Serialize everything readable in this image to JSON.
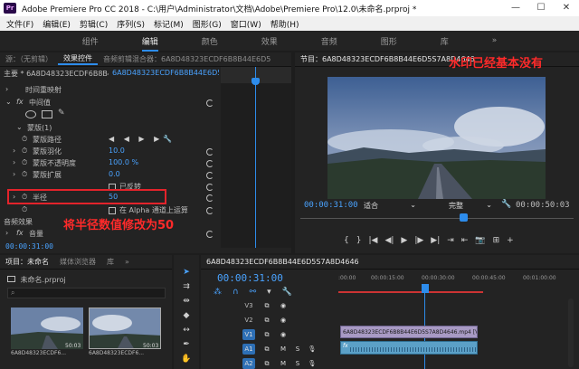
{
  "app": {
    "title": "Adobe Premiere Pro CC 2018 - C:\\用户\\Administrator\\文档\\Adobe\\Premiere Pro\\12.0\\未命名.prproj *",
    "logo_text": "Pr",
    "window_buttons": [
      "—",
      "☐",
      "✕"
    ]
  },
  "menu": [
    "文件(F)",
    "编辑(E)",
    "剪辑(C)",
    "序列(S)",
    "标记(M)",
    "图形(G)",
    "窗口(W)",
    "帮助(H)"
  ],
  "workspaces": {
    "items": [
      "组件",
      "编辑",
      "颜色",
      "效果",
      "音频",
      "图形",
      "库"
    ],
    "active": "编辑",
    "more": "»"
  },
  "effect_controls": {
    "tabs": [
      "源：（无剪辑）",
      "效果控件",
      "音频剪辑混合器：6A8D48323ECDF6B8B44E6D5",
      "元数据"
    ],
    "menu_icon": "≡",
    "master_label": "主要 * 6A8D48323ECDF6B8B4...",
    "clip_label": "6A8D48323ECDF6B8B44E6D5...",
    "rows": {
      "time_remap": "时间重映射",
      "intermediate": "中间值",
      "mask_name": "蒙版(1)",
      "mask_path": "蒙版路径",
      "mask_feather": "蒙版羽化",
      "mask_feather_val": "10.0",
      "mask_opacity": "蒙版不透明度",
      "mask_opacity_val": "100.0 %",
      "mask_expansion": "蒙版扩展",
      "mask_expansion_val": "0.0",
      "inverted": "已反转",
      "radius": "半径",
      "radius_val": "50",
      "alpha_option": "在 Alpha 通道上运算",
      "audio_effects": "音频效果",
      "volume": "音量"
    },
    "timecode": "00:00:31:00",
    "annotation": "将半径数值修改为50"
  },
  "program": {
    "tab": "节目：6A8D48323ECDF6B8B44E6D5S7A8D4646",
    "annotation": "水印已经基本没有",
    "timecode_current": "00:00:31:00",
    "fit": "适合",
    "quality": "完整",
    "timecode_duration": "00:00:50:03",
    "transport": [
      "{",
      "}",
      "|◀",
      "◀|",
      "▶",
      "|▶",
      "▶|",
      "⇥",
      "⇤",
      "📷",
      "⊞",
      "+"
    ]
  },
  "project": {
    "tabs": [
      "项目：未命名",
      "媒体浏览器",
      "库"
    ],
    "more": "»",
    "file": "未命名.prproj",
    "search_placeholder": "",
    "clips": [
      {
        "name": "6A8D48323ECDF6...",
        "duration": "50:03"
      },
      {
        "name": "6A8D48323ECDF6...",
        "duration": "50:03"
      }
    ]
  },
  "timeline": {
    "tab": "6A8D48323ECDF6B8B44E6D5S7A8D4646",
    "timecode": "00:00:31:00",
    "ruler": [
      ":00:00",
      "00:00:15:00",
      "00:00:30:00",
      "00:00:45:00",
      "00:01:00:00"
    ],
    "tracks": [
      "V3",
      "V2",
      "V1",
      "A1",
      "A2"
    ],
    "video_clip": "6A8D48323ECDF6B8B44E6D5S7A8D4646.mp4 [V]",
    "audio_clip": "fx"
  },
  "colors": {
    "accent": "#2d8ceb",
    "annotation": "#ff2a2a",
    "video_clip": "#a89ac4",
    "audio_clip": "#5ba0c7",
    "highlight": "#e3232b"
  }
}
